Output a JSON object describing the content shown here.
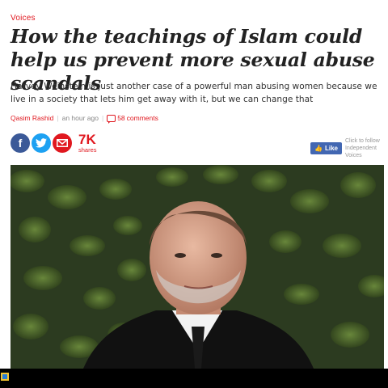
{
  "article": {
    "section": "Voices",
    "headline": "How the teachings of Islam could help us prevent more sexual abuse scandals",
    "standfirst": "Harvey Weinstein is just another case of a powerful man abusing women because we live in a society that lets him get away with it, but we can change that",
    "byline": {
      "author": "Qasim Rashid",
      "time": "an hour ago",
      "comments_count": "58",
      "comments_label": "comments"
    }
  },
  "share": {
    "facebook_icon": "f",
    "twitter_icon": "t",
    "email_icon": "email-icon",
    "count": "7K",
    "count_label": "shares"
  },
  "follow": {
    "like_label": "Like",
    "line1": "Click to follow",
    "line2": "Independent Voices"
  },
  "image": {
    "description_icon": "photo-of-man-in-suit"
  },
  "colors": {
    "accent": "#e0181f",
    "facebook": "#3b5998",
    "twitter": "#1da1f2",
    "like": "#4267b2"
  }
}
